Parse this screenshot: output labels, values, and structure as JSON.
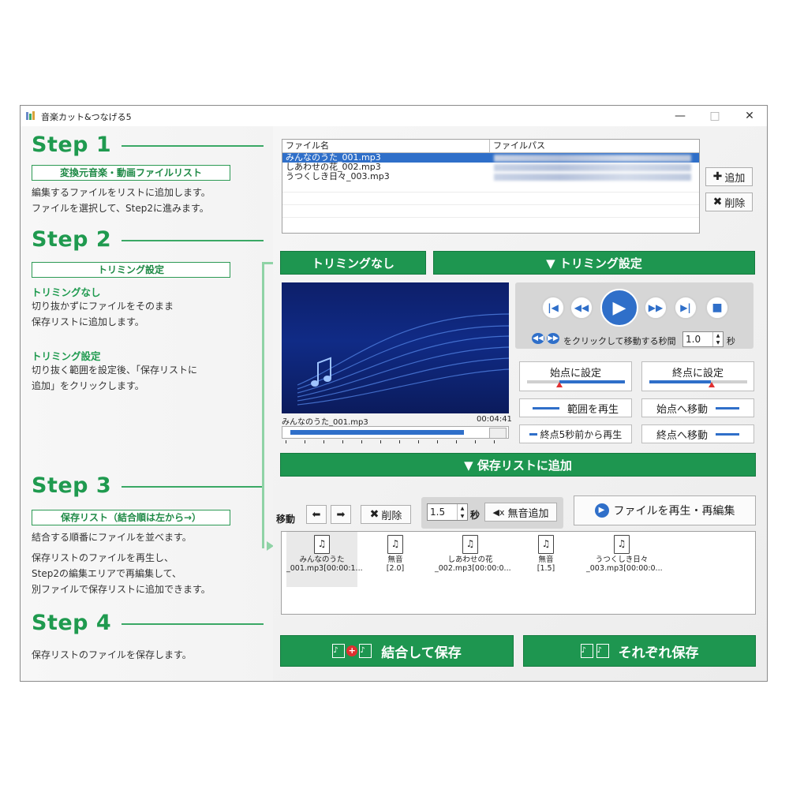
{
  "window": {
    "title": "音楽カット&つなげる5",
    "controls": {
      "minimize": "—",
      "maximize": "□",
      "close": "✕"
    }
  },
  "colors": {
    "accent_green": "#1e9650",
    "accent_blue": "#2f6fc9",
    "step_green": "#1f9a4f"
  },
  "left": {
    "step1": {
      "title": "Step 1",
      "section": "変換元音楽・動画ファイルリスト",
      "desc": "編集するファイルをリストに追加します。\nファイルを選択して、Step2に進みます。"
    },
    "step2": {
      "title": "Step 2",
      "section": "トリミング設定",
      "sub1": "トリミングなし",
      "desc1": "切り抜かずにファイルをそのまま\n保存リストに追加します。",
      "sub2": "トリミング設定",
      "desc2": "切り抜く範囲を設定後、「保存リストに\n追加」をクリックします。"
    },
    "step3": {
      "title": "Step 3",
      "section": "保存リスト（結合順は左から→）",
      "desc1": "結合する順番にファイルを並べます。",
      "desc2": "保存リストのファイルを再生し、\nStep2の編集エリアで再編集して、\n別ファイルで保存リストに追加できます。"
    },
    "step4": {
      "title": "Step 4",
      "desc": "保存リストのファイルを保存します。"
    }
  },
  "file_list": {
    "columns": [
      "ファイル名",
      "ファイルパス"
    ],
    "rows": [
      {
        "name": "みんなのうた_001.mp3",
        "selected": true
      },
      {
        "name": "しあわせの花_002.mp3",
        "selected": false
      },
      {
        "name": "うつくしき日々_003.mp3",
        "selected": false
      }
    ],
    "add_label": "追加",
    "delete_label": "削除"
  },
  "trimming": {
    "none_label": "トリミングなし",
    "set_label": "▼ トリミング設定"
  },
  "player": {
    "filename": "みんなのうた_001.mp3",
    "duration": "00:04:41",
    "progress": 0.88
  },
  "controls": {
    "seek_text": "をクリックして移動する秒間",
    "seek_value": "1.0",
    "seek_unit": "秒",
    "set_start": "始点に設定",
    "set_end": "終点に設定",
    "play_range": "範囲を再生",
    "goto_start": "始点へ移動",
    "play_from_end": "終点5秒前から再生",
    "goto_end": "終点へ移動"
  },
  "add_to_savelist": "▼ 保存リストに追加",
  "savelist_toolbar": {
    "move_label": "移動",
    "delete_label": "削除",
    "silence_value": "1.5",
    "silence_unit": "秒",
    "add_silence": "無音追加",
    "play_reedit": "ファイルを再生・再編集"
  },
  "savelist_items": [
    {
      "line1": "みんなのうた",
      "line2": "_001.mp3[00:00:1..."
    },
    {
      "line1": "無音",
      "line2": "[2.0]"
    },
    {
      "line1": "しあわせの花",
      "line2": "_002.mp3[00:00:0..."
    },
    {
      "line1": "無音",
      "line2": "[1.5]"
    },
    {
      "line1": "うつくしき日々",
      "line2": "_003.mp3[00:00:0..."
    }
  ],
  "save": {
    "merge_save": "結合して保存",
    "separate_save": "それぞれ保存"
  }
}
